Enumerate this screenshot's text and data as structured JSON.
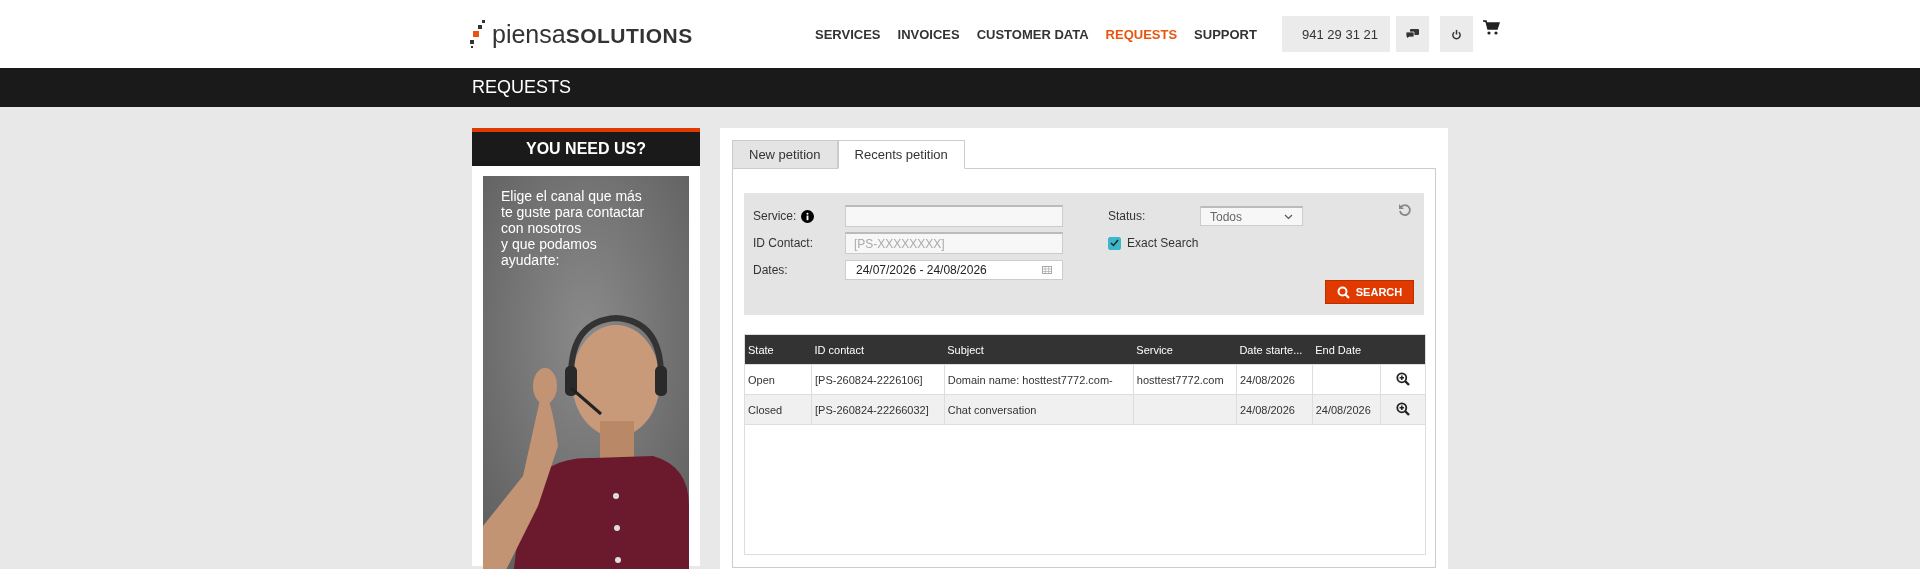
{
  "header": {
    "logo": "piensa**SOLUTIONS**",
    "nav": [
      {
        "label": "SERVICES",
        "selected": false
      },
      {
        "label": "INVOICES",
        "selected": false
      },
      {
        "label": "CUSTOMER DATA",
        "selected": false
      },
      {
        "label": "REQUESTS",
        "selected": true
      },
      {
        "label": "SUPPORT",
        "selected": false
      }
    ],
    "phone": "941 29 31 21"
  },
  "page_title": "REQUESTS",
  "sidebar": {
    "title": "YOU NEED US?",
    "banner": {
      "kind": "picture",
      "lines": [
        "Elige el canal que más",
        "te guste para contactar",
        "con nosotros",
        "y que podamos",
        "ayudarte:"
      ]
    }
  },
  "tabs": [
    {
      "label": "New petition",
      "selected": false
    },
    {
      "label": "Recents petition",
      "selected": true
    }
  ],
  "filters": {
    "service": {
      "label": "Service:"
    },
    "id_contact": {
      "label": "ID Contact:",
      "placeholder": "[PS-XXXXXXXX]"
    },
    "dates": {
      "label": "Dates:",
      "value": "24/07/2026 - 24/08/2026"
    },
    "status": {
      "label": "Status:",
      "value": "Todos"
    },
    "exact_search": {
      "label": "Exact Search",
      "checked": true
    },
    "search_button": "SEARCH"
  },
  "table": {
    "columns": [
      "State",
      "ID contact",
      "Subject",
      "Service",
      "Date starte...",
      "End Date"
    ],
    "rows": [
      {
        "cells": [
          "Open",
          "[PS-260824-2226106]",
          "Domain name: hosttest7772.com-",
          "hosttest7772.com",
          "24/08/2026",
          ""
        ]
      },
      {
        "cells": [
          "Closed",
          "[PS-260824-22266032]",
          "Chat conversation",
          "",
          "24/08/2026",
          "24/08/2026"
        ]
      }
    ]
  }
}
